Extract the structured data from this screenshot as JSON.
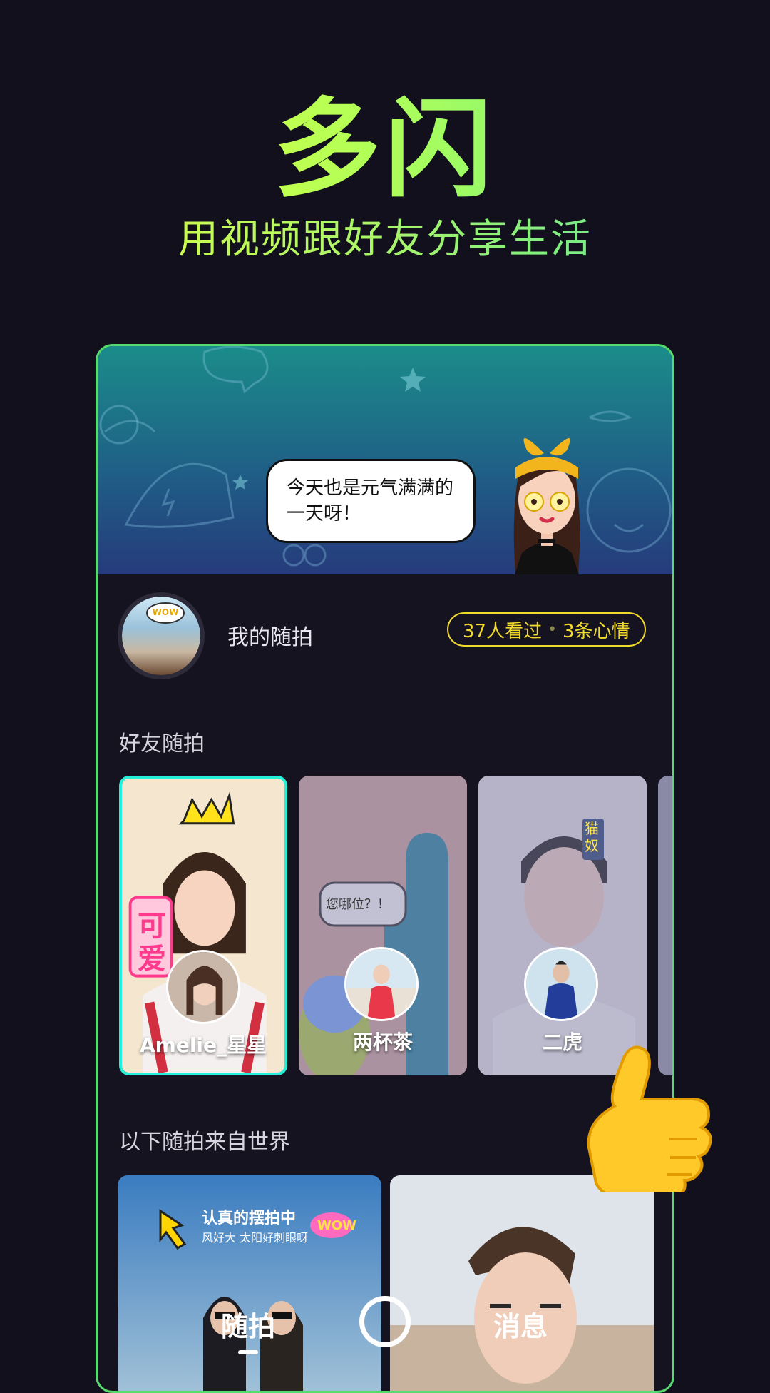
{
  "header": {
    "app_title": "多闪",
    "subtitle": "用视频跟好友分享生活"
  },
  "banner": {
    "speech_bubble": "今天也是元气满满的一天呀！"
  },
  "my_snaps": {
    "label": "我的随拍",
    "avatar_badge": "WOW",
    "viewers": "37人看过",
    "separator": "•",
    "moods": "3条心情"
  },
  "friends_section": {
    "title": "好友随拍",
    "friends": [
      {
        "name": "Amelie_星星",
        "sticker": "可爱",
        "selected": true
      },
      {
        "name": "两杯茶",
        "sticker": "您哪位？！",
        "selected": false
      },
      {
        "name": "二虎",
        "sticker": "猫奴",
        "selected": false
      }
    ]
  },
  "world_section": {
    "title": "以下随拍来自世界",
    "cards": [
      {
        "caption": "认真的摆拍中",
        "sub_caption": "风好大 太阳好刺眼呀",
        "badge": "WOW"
      },
      {
        "caption": ""
      }
    ]
  },
  "bottom_nav": {
    "left": "随拍",
    "right": "消息"
  },
  "colors": {
    "background": "#12101c",
    "accent_green": "#57d96f",
    "accent_yellow": "#f2da2a",
    "selected_border": "#25f0d8"
  }
}
